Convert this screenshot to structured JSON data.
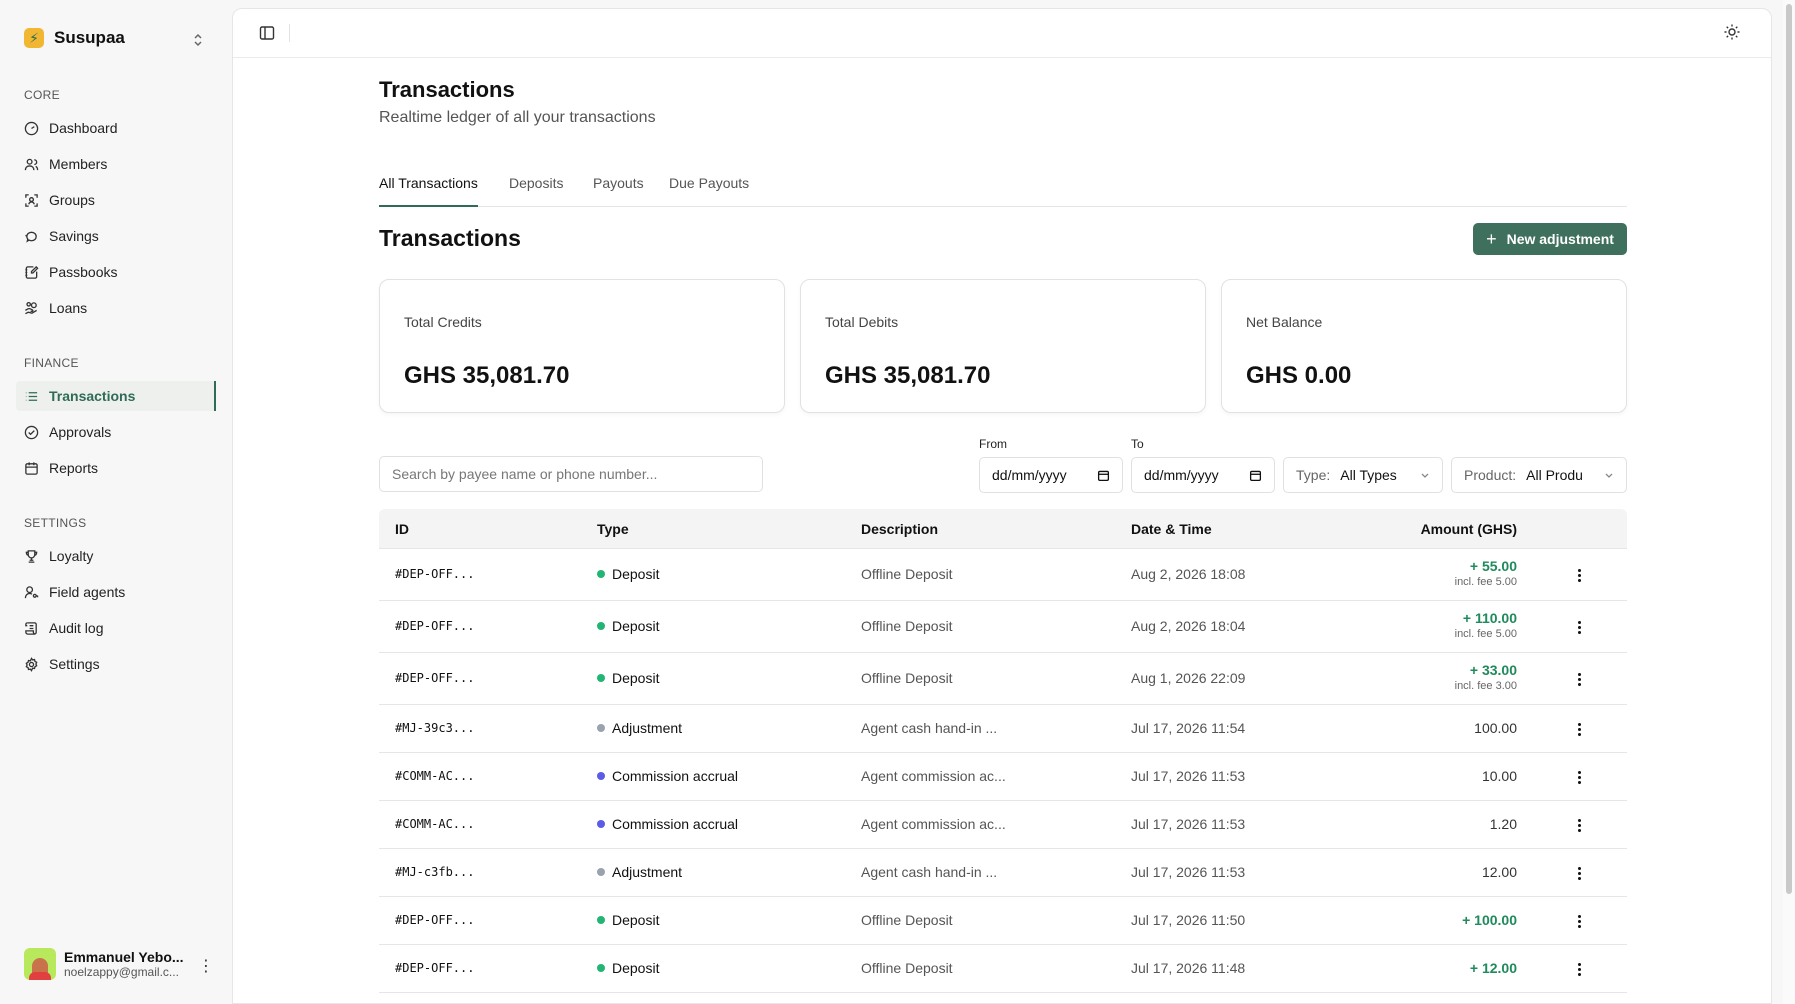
{
  "app": {
    "name": "Susupaa"
  },
  "sidebar": {
    "sections": [
      {
        "label": "CORE",
        "items": [
          "Dashboard",
          "Members",
          "Groups",
          "Savings",
          "Passbooks",
          "Loans"
        ]
      },
      {
        "label": "FINANCE",
        "items": [
          "Transactions",
          "Approvals",
          "Reports"
        ]
      },
      {
        "label": "SETTINGS",
        "items": [
          "Loyalty",
          "Field agents",
          "Audit log",
          "Settings"
        ]
      }
    ],
    "active_item": "Transactions"
  },
  "user": {
    "name": "Emmanuel Yebo...",
    "email": "noelzappy@gmail.c..."
  },
  "page": {
    "title": "Transactions",
    "subtitle": "Realtime ledger of all your transactions"
  },
  "tabs": [
    "All Transactions",
    "Deposits",
    "Payouts",
    "Due Payouts"
  ],
  "section": {
    "title": "Transactions",
    "new_button": "New adjustment"
  },
  "cards": [
    {
      "label": "Total Credits",
      "value": "GHS 35,081.70"
    },
    {
      "label": "Total Debits",
      "value": "GHS 35,081.70"
    },
    {
      "label": "Net Balance",
      "value": "GHS 0.00"
    }
  ],
  "filters": {
    "search_placeholder": "Search by payee name or phone number...",
    "from_label": "From",
    "from_value": "dd/mm/yyyy",
    "to_label": "To",
    "to_value": "dd/mm/yyyy",
    "type_label": "Type:",
    "type_value": "All Types",
    "product_label": "Product:",
    "product_value": "All Produ"
  },
  "table": {
    "headers": [
      "ID",
      "Type",
      "Description",
      "Date & Time",
      "Amount (GHS)"
    ],
    "rows": [
      {
        "id": "#DEP-OFF...",
        "type": "Deposit",
        "dot_color": "#22b573",
        "description": "Offline Deposit",
        "datetime": "Aug 2, 2026 18:08",
        "amount": "+ 55.00",
        "fee": "incl. fee 5.00",
        "credit": true
      },
      {
        "id": "#DEP-OFF...",
        "type": "Deposit",
        "dot_color": "#22b573",
        "description": "Offline Deposit",
        "datetime": "Aug 2, 2026 18:04",
        "amount": "+ 110.00",
        "fee": "incl. fee 5.00",
        "credit": true
      },
      {
        "id": "#DEP-OFF...",
        "type": "Deposit",
        "dot_color": "#22b573",
        "description": "Offline Deposit",
        "datetime": "Aug 1, 2026 22:09",
        "amount": "+ 33.00",
        "fee": "incl. fee 3.00",
        "credit": true
      },
      {
        "id": "#MJ-39c3...",
        "type": "Adjustment",
        "dot_color": "#9aa3ad",
        "description": "Agent cash hand-in ...",
        "datetime": "Jul 17, 2026 11:54",
        "amount": "100.00",
        "fee": "",
        "credit": false
      },
      {
        "id": "#COMM-AC...",
        "type": "Commission accrual",
        "dot_color": "#5b5be8",
        "description": "Agent commission ac...",
        "datetime": "Jul 17, 2026 11:53",
        "amount": "10.00",
        "fee": "",
        "credit": false
      },
      {
        "id": "#COMM-AC...",
        "type": "Commission accrual",
        "dot_color": "#5b5be8",
        "description": "Agent commission ac...",
        "datetime": "Jul 17, 2026 11:53",
        "amount": "1.20",
        "fee": "",
        "credit": false
      },
      {
        "id": "#MJ-c3fb...",
        "type": "Adjustment",
        "dot_color": "#9aa3ad",
        "description": "Agent cash hand-in ...",
        "datetime": "Jul 17, 2026 11:53",
        "amount": "12.00",
        "fee": "",
        "credit": false
      },
      {
        "id": "#DEP-OFF...",
        "type": "Deposit",
        "dot_color": "#22b573",
        "description": "Offline Deposit",
        "datetime": "Jul 17, 2026 11:50",
        "amount": "+ 100.00",
        "fee": "",
        "credit": true
      },
      {
        "id": "#DEP-OFF...",
        "type": "Deposit",
        "dot_color": "#22b573",
        "description": "Offline Deposit",
        "datetime": "Jul 17, 2026 11:48",
        "amount": "+ 12.00",
        "fee": "",
        "credit": true
      }
    ]
  },
  "colors": {
    "accent": "#2f6b56",
    "credit": "#1f8a5b",
    "button": "#3f6f5d"
  }
}
